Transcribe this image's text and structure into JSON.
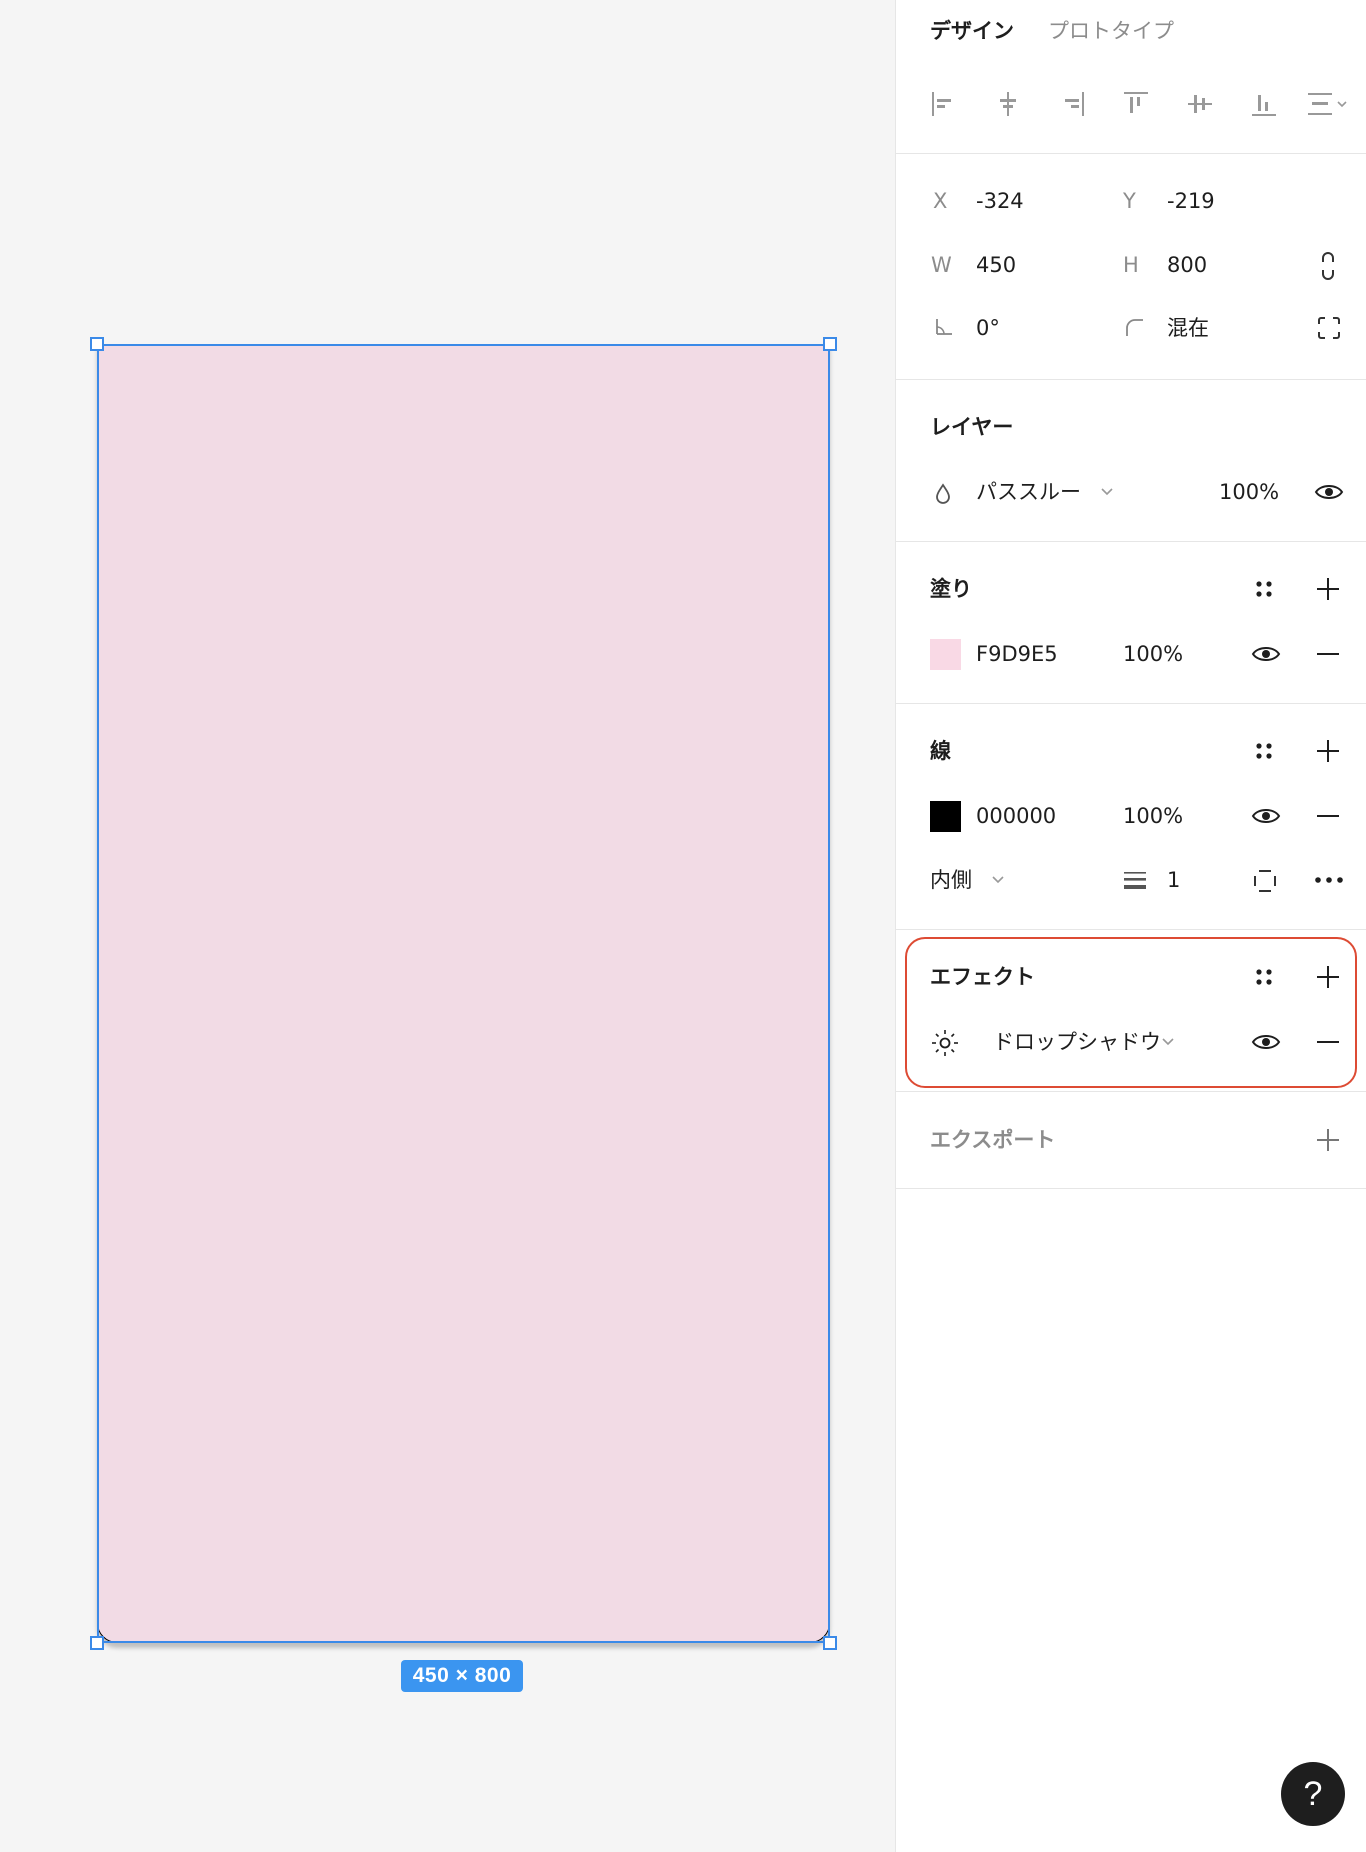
{
  "canvas": {
    "frame_fill_color": "#F2DBE5",
    "frame_stroke_color": "#000000",
    "selection_color": "#3b8ae8",
    "size_label": "450 × 800"
  },
  "panel": {
    "tabs": {
      "design": "デザイン",
      "prototype": "プロトタイプ"
    },
    "align_icons": [
      "align-left-icon",
      "align-horizontal-center-icon",
      "align-right-icon",
      "align-top-icon",
      "align-vertical-center-icon",
      "align-bottom-icon",
      "distribute-icon"
    ],
    "geometry": {
      "x_label": "X",
      "x_value": "-324",
      "y_label": "Y",
      "y_value": "-219",
      "w_label": "W",
      "w_value": "450",
      "h_label": "H",
      "h_value": "800",
      "rotation_value": "0°",
      "radius_value": "混在"
    },
    "layer": {
      "title": "レイヤー",
      "blend_mode": "パススルー",
      "opacity": "100%"
    },
    "fill": {
      "title": "塗り",
      "hex": "F9D9E5",
      "opacity": "100%",
      "swatch_color": "#F9D9E5"
    },
    "stroke": {
      "title": "線",
      "hex": "000000",
      "opacity": "100%",
      "swatch_color": "#000000",
      "position": "内側",
      "weight": "1"
    },
    "effect": {
      "title": "エフェクト",
      "type": "ドロップシャドウ",
      "highlight_color": "#dd4b34"
    },
    "export": {
      "title": "エクスポート"
    },
    "help": "?"
  }
}
